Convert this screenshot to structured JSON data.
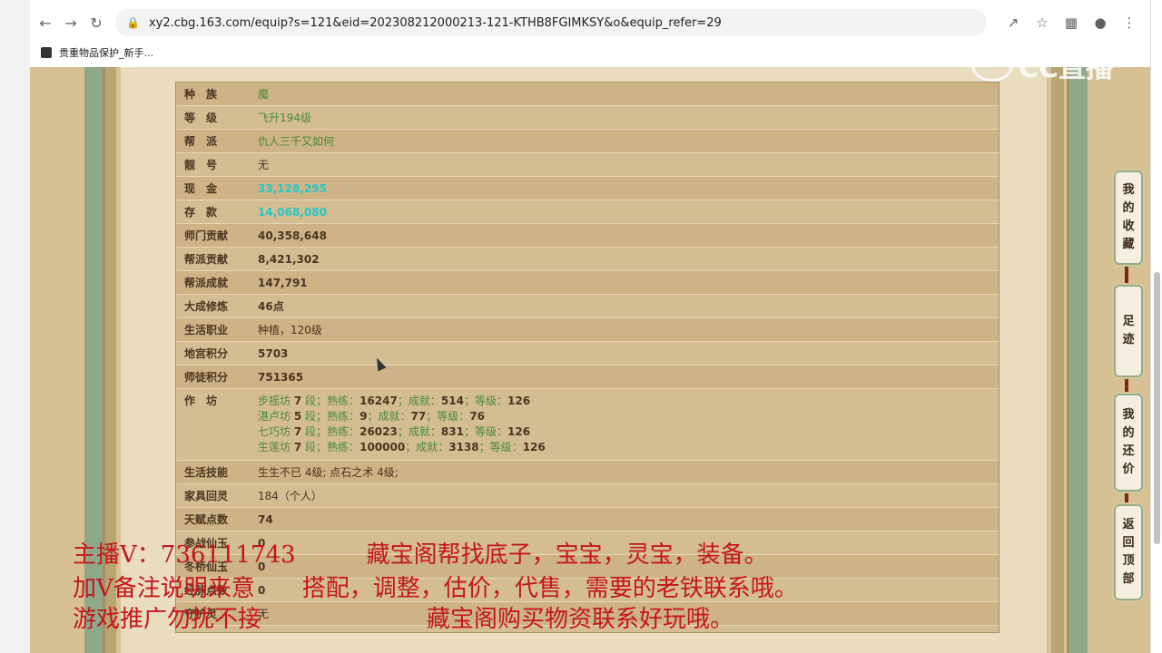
{
  "browser": {
    "url": "xy2.cbg.163.com/equip?s=121&eid=202308212000213-121-KTHB8FGIMKSY&o&equip_refer=29",
    "bookmark_label": "贵重物品保护_新手..."
  },
  "logo_text": "CC直播",
  "rows": [
    {
      "label": "种　族",
      "value": "魔"
    },
    {
      "label": "等　级",
      "value": "飞升194级"
    },
    {
      "label": "帮　派",
      "value": "仇人三千又如何"
    },
    {
      "label": "靓　号",
      "value": "无"
    },
    {
      "label": "现　金",
      "value": "33,128,295"
    },
    {
      "label": "存　款",
      "value": "14,068,080"
    },
    {
      "label": "师门贡献",
      "value": "40,358,648"
    },
    {
      "label": "帮派贡献",
      "value": "8,421,302"
    },
    {
      "label": "帮派成就",
      "value": "147,791"
    },
    {
      "label": "大成修炼",
      "value": "46点"
    },
    {
      "label": "生活职业",
      "value": "种植，120级"
    },
    {
      "label": "地宫积分",
      "value": "5703"
    },
    {
      "label": "师徒积分",
      "value": "751365"
    }
  ],
  "workshop": {
    "label": "作　坊",
    "lines": [
      {
        "name": "步摇坊",
        "seg": "7",
        "seg_unit": "段",
        "p_label": "熟练",
        "p": "16247",
        "a_label": "成就",
        "a": "514",
        "l_label": "等级",
        "l": "126"
      },
      {
        "name": "湛卢坊",
        "seg": "5",
        "seg_unit": "段",
        "p_label": "熟练",
        "p": "9",
        "a_label": "成就",
        "a": "77",
        "l_label": "等级",
        "l": "76"
      },
      {
        "name": "七巧坊",
        "seg": "7",
        "seg_unit": "段",
        "p_label": "熟练",
        "p": "26023",
        "a_label": "成就",
        "a": "831",
        "l_label": "等级",
        "l": "126"
      },
      {
        "name": "生莲坊",
        "seg": "7",
        "seg_unit": "段",
        "p_label": "熟练",
        "p": "100000",
        "a_label": "成就",
        "a": "3138",
        "l_label": "等级",
        "l": "126"
      }
    ]
  },
  "rows2": [
    {
      "label": "生活技能",
      "value": "生生不已 4级; 点石之术 4级;"
    },
    {
      "label": "家具回灵",
      "value": "184（个人）"
    },
    {
      "label": "天赋点数",
      "value": "74"
    },
    {
      "label": "参战仙玉",
      "value": "0"
    },
    {
      "label": "冬桥仙玉",
      "value": "0"
    },
    {
      "label": "经脉点数",
      "value": "0"
    },
    {
      "label": "守护灵",
      "value": "无"
    }
  ],
  "side_buttons": [
    {
      "label": "我的收藏",
      "chars": [
        "我",
        "的",
        "收",
        "藏"
      ]
    },
    {
      "label": "足迹",
      "chars": [
        "足",
        "迹"
      ]
    },
    {
      "label": "我的还价",
      "chars": [
        "我",
        "的",
        "还",
        "价"
      ]
    },
    {
      "label": "返回顶部",
      "chars": [
        "返",
        "回",
        "顶",
        "部"
      ]
    }
  ],
  "overlay": {
    "line1": "主播V：736111743　　　藏宝阁帮找底子，宝宝，灵宝，装备。",
    "line2": "加V备注说明来意　　搭配，调整，估价，代售，需要的老铁联系哦。",
    "line3": "游戏推广勿扰不接　　　　　　　藏宝阁购买物资联系好玩哦。"
  },
  "colors": {
    "page_bg": "#d8c095",
    "panel_bg": "#d4bd93",
    "cyan_value": "#29c6c6",
    "green_value": "#4b8a3a",
    "overlay_red": "#c4161c"
  }
}
